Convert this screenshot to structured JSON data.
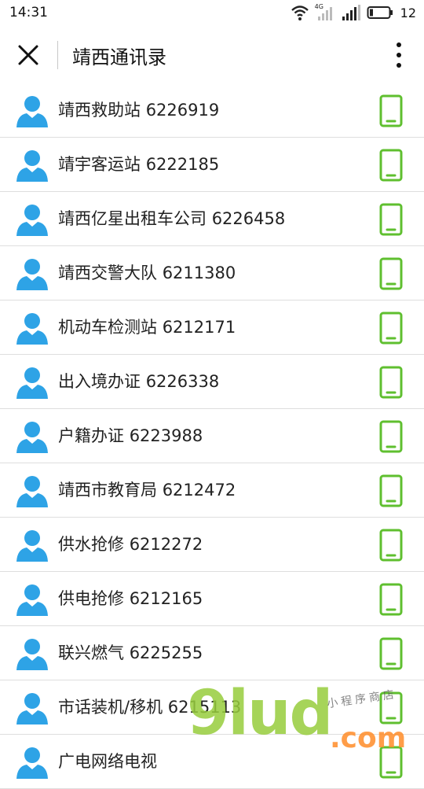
{
  "status_bar": {
    "time": "14:31",
    "network_label": "4G",
    "battery_level": "12"
  },
  "nav": {
    "title": "靖西通讯录"
  },
  "contacts": [
    {
      "name": "靖西救助站",
      "phone": "6226919"
    },
    {
      "name": "靖宇客运站",
      "phone": "6222185"
    },
    {
      "name": "靖西亿星出租车公司",
      "phone": "6226458"
    },
    {
      "name": "靖西交警大队",
      "phone": "6211380"
    },
    {
      "name": "机动车检测站",
      "phone": "6212171"
    },
    {
      "name": "出入境办证",
      "phone": "6226338"
    },
    {
      "name": "户籍办证",
      "phone": "6223988"
    },
    {
      "name": "靖西市教育局",
      "phone": "6212472"
    },
    {
      "name": "供水抢修",
      "phone": "6212272"
    },
    {
      "name": "供电抢修",
      "phone": "6212165"
    },
    {
      "name": "联兴燃气",
      "phone": "6225255"
    },
    {
      "name": "市话装机/移机",
      "phone": "6215113"
    },
    {
      "name": "广电网络电视",
      "phone": ""
    }
  ],
  "watermark": {
    "main": "9lud",
    "sub": ".com",
    "slogan": "小程序商店"
  },
  "colors": {
    "avatar": "#2ea3e6",
    "phone_icon": "#5fbf2f",
    "divider": "#dedede"
  },
  "icons": {
    "close": "close-icon",
    "more": "more-vertical-icon",
    "avatar": "person-icon",
    "phone": "mobile-phone-icon"
  }
}
